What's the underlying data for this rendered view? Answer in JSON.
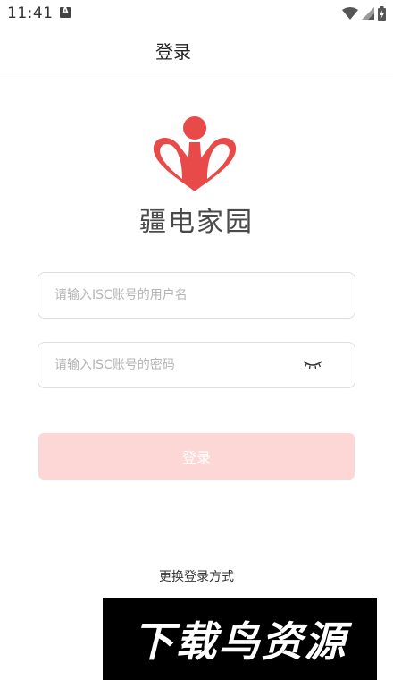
{
  "status_bar": {
    "time": "11:41",
    "notification_letter": "A"
  },
  "header": {
    "title": "登录"
  },
  "brand": {
    "name": "疆电家园",
    "logo_color": "#e84a4a"
  },
  "form": {
    "username_placeholder": "请输入ISC账号的用户名",
    "username_value": "",
    "password_placeholder": "请输入ISC账号的密码",
    "password_value": ""
  },
  "login_button": {
    "label": "登录",
    "color": "#fdd6d6"
  },
  "switch_login": {
    "label": "更换登录方式"
  },
  "watermark": {
    "text": "下载鸟资源"
  }
}
